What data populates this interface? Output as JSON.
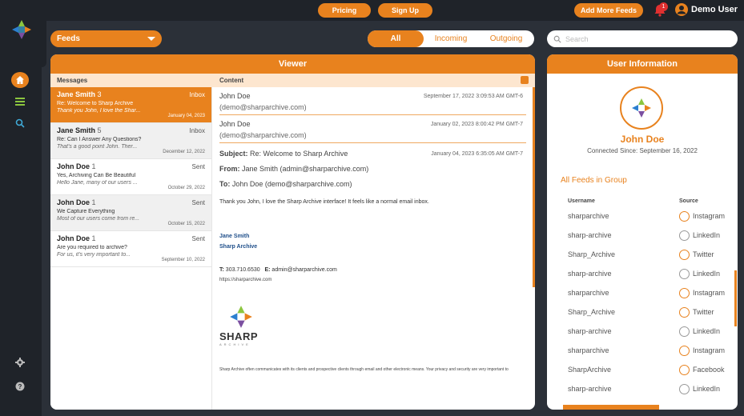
{
  "topbar": {
    "pricing": "Pricing",
    "signup": "Sign Up",
    "add_feeds": "Add More Feeds",
    "notif_count": "1",
    "user": "Demo User"
  },
  "sidebar": {
    "items": [
      {
        "icon": "home-icon",
        "active": true
      },
      {
        "icon": "list-icon"
      },
      {
        "icon": "search-icon"
      }
    ],
    "bottom": [
      {
        "icon": "gear-icon"
      },
      {
        "icon": "help-icon"
      }
    ]
  },
  "filters": {
    "feeds_label": "Feeds",
    "tabs": [
      "All",
      "Incoming",
      "Outgoing"
    ],
    "search_placeholder": "Search"
  },
  "viewer": {
    "title": "Viewer",
    "messages_header": "Messages",
    "content_header": "Content",
    "messages": [
      {
        "from": "Jane Smith",
        "count": "3",
        "folder": "Inbox",
        "subject": "Re: Welcome to Sharp Archive",
        "preview": "Thank you John, I love the Shar...",
        "date": "January 04, 2023"
      },
      {
        "from": "Jane Smith",
        "count": "5",
        "folder": "Inbox",
        "subject": "Re: Can I Answer Any Questions?",
        "preview": "That's a good point John. Ther...",
        "date": "December 12, 2022"
      },
      {
        "from": "John Doe",
        "count": "1",
        "folder": "Sent",
        "subject": "Yes, Archiving Can Be Beautiful",
        "preview": "Hello Jane, many of our users ...",
        "date": "October 29, 2022"
      },
      {
        "from": "John Doe",
        "count": "1",
        "folder": "Sent",
        "subject": "We Capture Everything",
        "preview": "Most of our users come from re...",
        "date": "October 15, 2022"
      },
      {
        "from": "John Doe",
        "count": "1",
        "folder": "Sent",
        "subject": "Are you required to archive?",
        "preview": "For us, it's very important to...",
        "date": "September 10, 2022"
      }
    ],
    "thread": [
      {
        "name": "John Doe",
        "email": "(demo@sharparchive.com)",
        "date": "September 17, 2022 3:09:53 AM GMT-6"
      },
      {
        "name": "John Doe",
        "email": "(demo@sharparchive.com)",
        "date": "January 02, 2023 8:00:42 PM GMT-7"
      }
    ],
    "detail": {
      "subject_label": "Subject:",
      "subject": "Re: Welcome to Sharp Archive",
      "date": "January 04, 2023 6:35:05 AM GMT-7",
      "from_label": "From:",
      "from": "Jane Smith (admin@sharparchive.com)",
      "to_label": "To:",
      "to": "John Doe (demo@sharparchive.com)",
      "body": "Thank you John, I love the Sharp Archive interface! It feels like a normal email inbox.",
      "sig_name": "Jane Smith",
      "sig_company": "Sharp Archive",
      "phone_label": "T:",
      "phone": "303.710.6530",
      "email_label": "E:",
      "email": "admin@sharparchive.com",
      "url": "https://sharparchive.com",
      "logo_text": "SHARP",
      "logo_sub": "ARCHIVE",
      "disclaimer": "Sharp Archive often communicates with its clients and prospective clients through email and other electronic means. Your privacy and security are very important to"
    }
  },
  "user_info": {
    "title": "User Information",
    "name": "John Doe",
    "since": "Connected Since: September 16, 2022",
    "group_title": "All Feeds in Group",
    "col_username": "Username",
    "col_source": "Source",
    "feeds": [
      {
        "username": "sharparchive",
        "source": "Instagram"
      },
      {
        "username": "sharp-archive",
        "source": "LinkedIn"
      },
      {
        "username": "Sharp_Archive",
        "source": "Twitter"
      },
      {
        "username": "sharp-archive",
        "source": "LinkedIn"
      },
      {
        "username": "sharparchive",
        "source": "Instagram"
      },
      {
        "username": "Sharp_Archive",
        "source": "Twitter"
      },
      {
        "username": "sharp-archive",
        "source": "LinkedIn"
      },
      {
        "username": "sharparchive",
        "source": "Instagram"
      },
      {
        "username": "SharpArchive",
        "source": "Facebook"
      },
      {
        "username": "sharp-archive",
        "source": "LinkedIn"
      }
    ]
  }
}
